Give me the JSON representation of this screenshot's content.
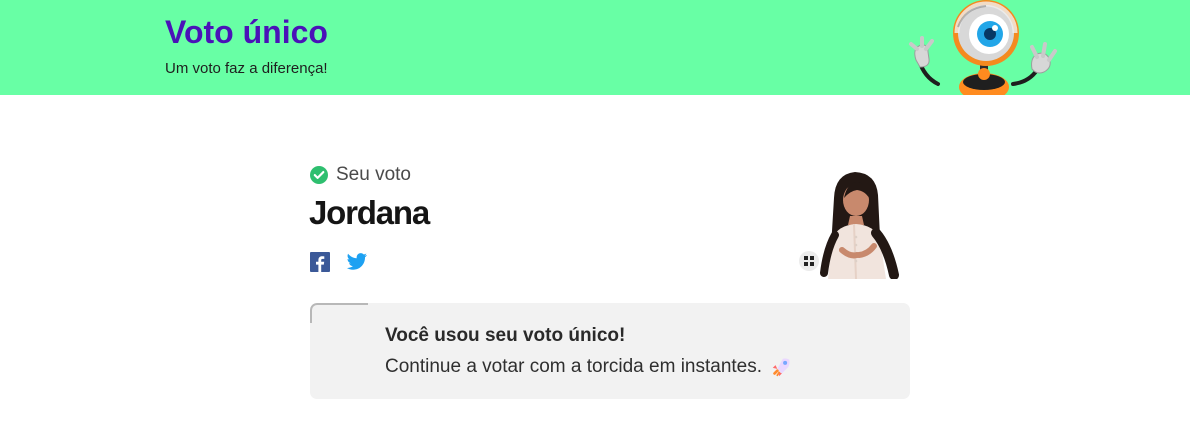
{
  "header": {
    "title": "Voto único",
    "subtitle": "Um voto faz a diferença!",
    "mascot_icon": "eye-mascot-icon",
    "background_color": "#68ffa5",
    "title_color": "#4a12b8"
  },
  "vote": {
    "label": "Seu voto",
    "candidate": "Jordana",
    "status_icon": "check-circle-icon",
    "status_color": "#2ebf6f"
  },
  "social": {
    "facebook_icon": "facebook-icon",
    "twitter_icon": "twitter-icon"
  },
  "photo": {
    "badge_icon": "grid-icon"
  },
  "message": {
    "title": "Você usou seu voto único!",
    "text": "Continue a votar com a torcida em instantes.",
    "icon": "rocket-icon"
  }
}
